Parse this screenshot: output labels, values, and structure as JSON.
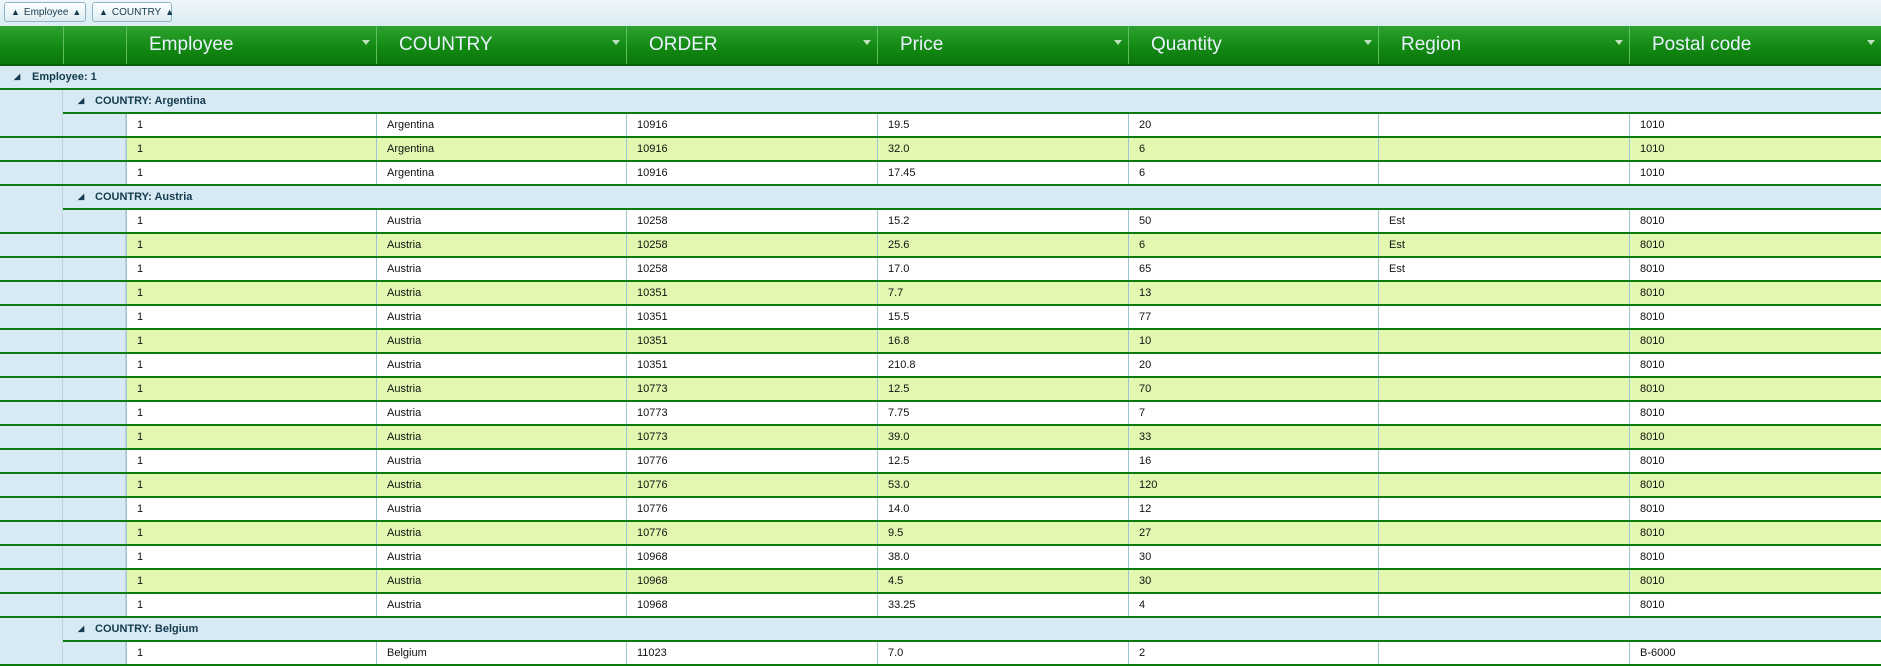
{
  "grouping": {
    "chips": [
      {
        "label": "Employee",
        "arrow": "▲"
      },
      {
        "label": "COUNTRY",
        "arrow": "▲"
      }
    ]
  },
  "columns": [
    "Employee",
    "COUNTRY",
    "ORDER",
    "Price",
    "Quantity",
    "Region",
    "Postal code"
  ],
  "icons": {
    "expanded": "◢",
    "sort": "chevron-down-icon"
  },
  "colors": {
    "header": "#138a13",
    "alt_row": "#e2f7b0",
    "group_bg": "#d7eaf3"
  },
  "groups": [
    {
      "label": "Employee: 1",
      "subgroups": [
        {
          "label": "COUNTRY: Argentina",
          "rows": [
            [
              "1",
              "Argentina",
              "10916",
              "19.5",
              "20",
              "",
              "1010"
            ],
            [
              "1",
              "Argentina",
              "10916",
              "32.0",
              "6",
              "",
              "1010"
            ],
            [
              "1",
              "Argentina",
              "10916",
              "17.45",
              "6",
              "",
              "1010"
            ]
          ]
        },
        {
          "label": "COUNTRY: Austria",
          "rows": [
            [
              "1",
              "Austria",
              "10258",
              "15.2",
              "50",
              "Est",
              "8010"
            ],
            [
              "1",
              "Austria",
              "10258",
              "25.6",
              "6",
              "Est",
              "8010"
            ],
            [
              "1",
              "Austria",
              "10258",
              "17.0",
              "65",
              "Est",
              "8010"
            ],
            [
              "1",
              "Austria",
              "10351",
              "7.7",
              "13",
              "",
              "8010"
            ],
            [
              "1",
              "Austria",
              "10351",
              "15.5",
              "77",
              "",
              "8010"
            ],
            [
              "1",
              "Austria",
              "10351",
              "16.8",
              "10",
              "",
              "8010"
            ],
            [
              "1",
              "Austria",
              "10351",
              "210.8",
              "20",
              "",
              "8010"
            ],
            [
              "1",
              "Austria",
              "10773",
              "12.5",
              "70",
              "",
              "8010"
            ],
            [
              "1",
              "Austria",
              "10773",
              "7.75",
              "7",
              "",
              "8010"
            ],
            [
              "1",
              "Austria",
              "10773",
              "39.0",
              "33",
              "",
              "8010"
            ],
            [
              "1",
              "Austria",
              "10776",
              "12.5",
              "16",
              "",
              "8010"
            ],
            [
              "1",
              "Austria",
              "10776",
              "53.0",
              "120",
              "",
              "8010"
            ],
            [
              "1",
              "Austria",
              "10776",
              "14.0",
              "12",
              "",
              "8010"
            ],
            [
              "1",
              "Austria",
              "10776",
              "9.5",
              "27",
              "",
              "8010"
            ],
            [
              "1",
              "Austria",
              "10968",
              "38.0",
              "30",
              "",
              "8010"
            ],
            [
              "1",
              "Austria",
              "10968",
              "4.5",
              "30",
              "",
              "8010"
            ],
            [
              "1",
              "Austria",
              "10968",
              "33.25",
              "4",
              "",
              "8010"
            ]
          ]
        },
        {
          "label": "COUNTRY: Belgium",
          "rows": [
            [
              "1",
              "Belgium",
              "11023",
              "7.0",
              "2",
              "",
              "B-6000"
            ]
          ]
        }
      ]
    }
  ]
}
